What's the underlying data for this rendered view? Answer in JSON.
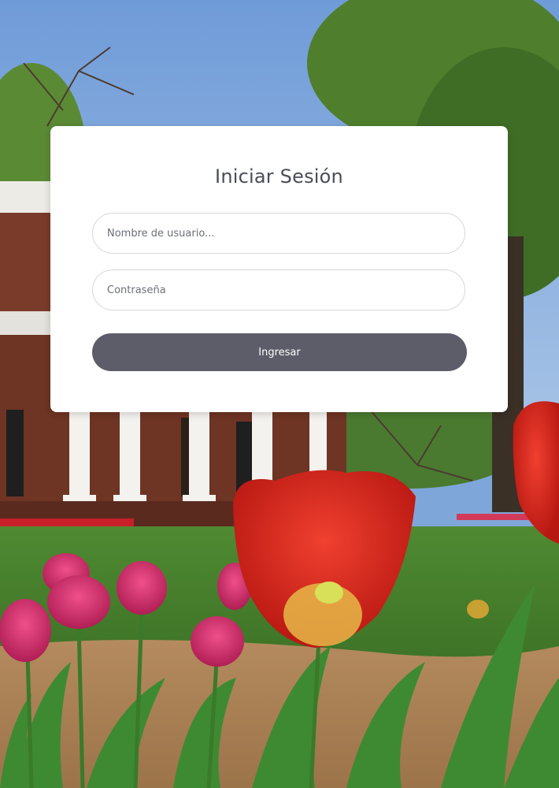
{
  "login": {
    "title": "Iniciar Sesión",
    "username_placeholder": "Nombre de usuario...",
    "password_placeholder": "Contraseña",
    "submit_label": "Ingresar"
  },
  "colors": {
    "button": "#5c5d69",
    "title": "#4a4d57",
    "card": "#ffffff"
  }
}
